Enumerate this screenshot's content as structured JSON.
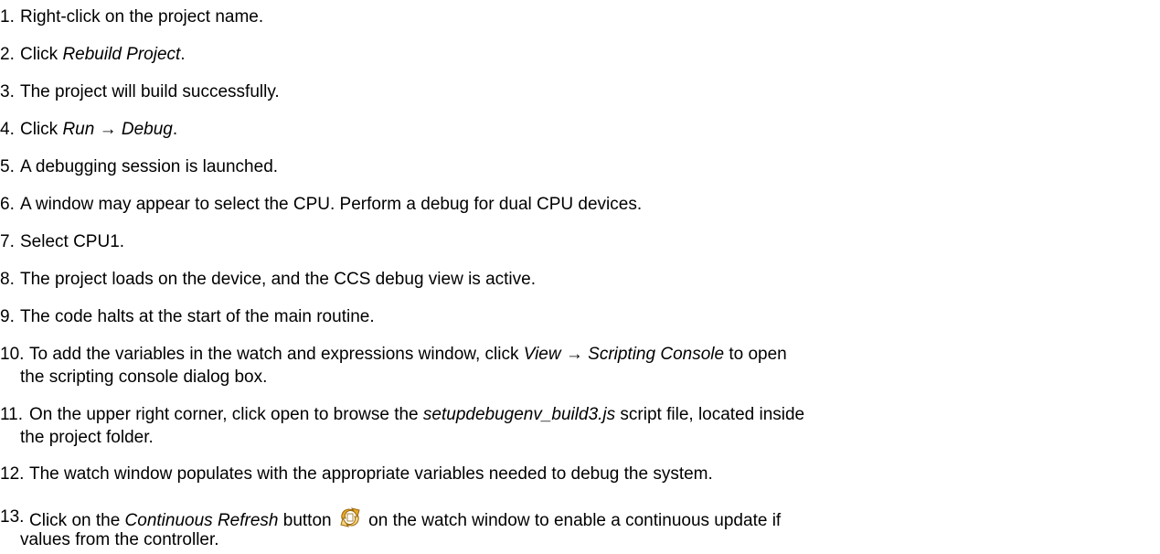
{
  "steps": [
    {
      "num": "1.",
      "text": "Right-click on the project name."
    },
    {
      "num": "2.",
      "pre": "Click ",
      "em": "Rebuild Project",
      "post": "."
    },
    {
      "num": "3.",
      "text": "The project will build successfully."
    },
    {
      "num": "4.",
      "pre": "Click ",
      "em": "Run → Debug",
      "post": "."
    },
    {
      "num": "5.",
      "text": "A debugging session is launched."
    },
    {
      "num": "6.",
      "text": "A window may appear to select the CPU. Perform a debug for dual CPU devices."
    },
    {
      "num": "7.",
      "text": "Select CPU1."
    },
    {
      "num": "8.",
      "text": "The project loads on the device, and the CCS debug view is active."
    },
    {
      "num": "9.",
      "text": "The code halts at the start of the main routine."
    },
    {
      "num": "10.",
      "pre": "To add the variables in the watch and expressions window, click ",
      "em": "View → Scripting Console",
      "post": " to open",
      "cont": "the scripting console dialog box."
    },
    {
      "num": "11.",
      "pre": "On the upper right corner, click open to browse the ",
      "em": "setupdebugenv_build3.js",
      "post": " script file, located inside",
      "cont": "the project folder."
    },
    {
      "num": "12.",
      "text": "The watch window populates with the appropriate variables needed to debug the system."
    },
    {
      "num": "13.",
      "pre": "Click on the ",
      "em": "Continuous Refresh",
      "mid": " button",
      "post": " on the watch window to enable a continuous update if",
      "cont": "values from the controller."
    }
  ],
  "icons": {
    "continuous_refresh": "continuous-refresh-icon",
    "colors": {
      "arrow_fill": "#e8a62a",
      "arrow_stroke": "#9a6a10",
      "arrow_light": "#f7d27a"
    }
  }
}
